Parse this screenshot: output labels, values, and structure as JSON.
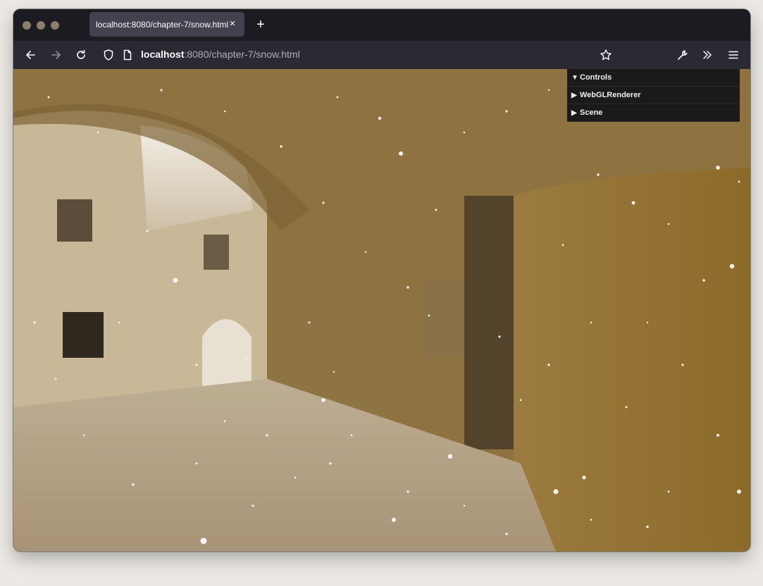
{
  "tab": {
    "title": "localhost:8080/chapter-7/snow.html",
    "close_glyph": "×"
  },
  "new_tab_glyph": "+",
  "address": {
    "host": "localhost",
    "path": ":8080/chapter-7/snow.html"
  },
  "icons": {
    "back": "arrow-left-icon",
    "forward": "arrow-right-icon",
    "reload": "reload-icon",
    "shield": "shield-icon",
    "page": "page-icon",
    "bookmark": "star-icon",
    "tools": "wrench-icon",
    "overflow": "chevrons-right-icon",
    "menu": "hamburger-menu-icon"
  },
  "gui": {
    "items": [
      {
        "label": "Controls",
        "expanded": true
      },
      {
        "label": "WebGLRenderer",
        "expanded": false
      },
      {
        "label": "Scene",
        "expanded": false
      }
    ]
  },
  "colors": {
    "chrome": "#1c1b22",
    "toolbar": "#2b2a33",
    "tab": "#42414d",
    "gui_bg": "#1a1a1a",
    "scene_tint": "#a88a55"
  }
}
